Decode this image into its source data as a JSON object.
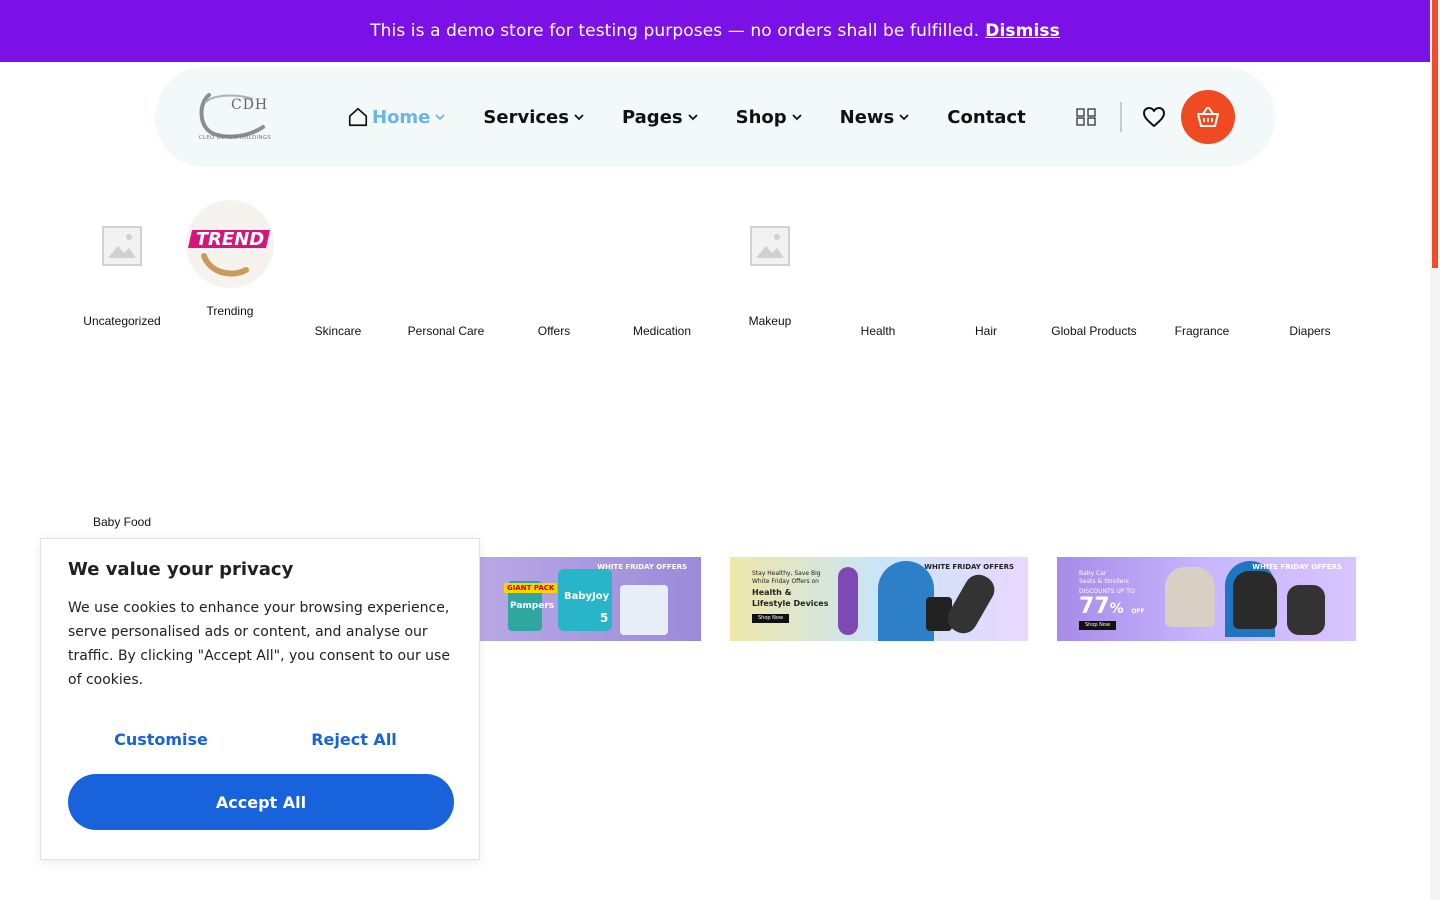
{
  "demo_notice": {
    "text": "This is a demo store for testing purposes — no orders shall be fulfilled.",
    "dismiss_label": "Dismiss",
    "bg_color": "#7b11e6"
  },
  "logo": {
    "mark": "CDH",
    "subtitle": "CLEO DUTCH HOLDINGS"
  },
  "nav": {
    "items": [
      {
        "label": "Home",
        "icon": "home-icon",
        "active": true
      },
      {
        "label": "Services"
      },
      {
        "label": "Pages"
      },
      {
        "label": "Shop"
      },
      {
        "label": "News"
      },
      {
        "label": "Contact"
      }
    ]
  },
  "header_icons": {
    "grid": "grid-icon",
    "wishlist": "heart-icon",
    "cart": "basket-icon",
    "cart_color": "#f04a22"
  },
  "categories": [
    {
      "label": "Uncategorized",
      "image": "placeholder"
    },
    {
      "label": "Trending",
      "image": "trend-logo",
      "image_text": "TREND"
    },
    {
      "label": "Skincare"
    },
    {
      "label": "Personal Care"
    },
    {
      "label": "Offers"
    },
    {
      "label": "Medication"
    },
    {
      "label": "Makeup",
      "image": "placeholder"
    },
    {
      "label": "Health"
    },
    {
      "label": "Hair"
    },
    {
      "label": "Global Products"
    },
    {
      "label": "Fragrance"
    },
    {
      "label": "Diapers"
    },
    {
      "label": "Baby Food"
    }
  ],
  "banners": [
    {
      "badge": "WHITE FRIDAY OFFERS",
      "brands": [
        "Pampers",
        "BabyJoy",
        "5"
      ],
      "tag": "GIANT PACK"
    },
    {
      "badge": "WHITE FRIDAY OFFERS",
      "lines": [
        "Stay Healthy, Save Big",
        "White Friday Offers on"
      ],
      "headline": "Health & Lifestyle Devices",
      "cta": "Shop Now"
    },
    {
      "badge": "WHITE FRIDAY OFFERS",
      "lines": [
        "Baby Car",
        "Seats & Strollers"
      ],
      "sub": "DISCOUNTS UP TO",
      "discount": "77",
      "unit": "%",
      "off": "OFF",
      "cta": "Shop Now"
    }
  ],
  "cookie_banner": {
    "title": "We value your privacy",
    "body": "We use cookies to enhance your browsing experience, serve personalised ads or content, and analyse our traffic. By clicking \"Accept All\", you consent to our use of cookies.",
    "customise_label": "Customise",
    "reject_label": "Reject All",
    "accept_label": "Accept All",
    "accent_color": "#1863dc"
  }
}
